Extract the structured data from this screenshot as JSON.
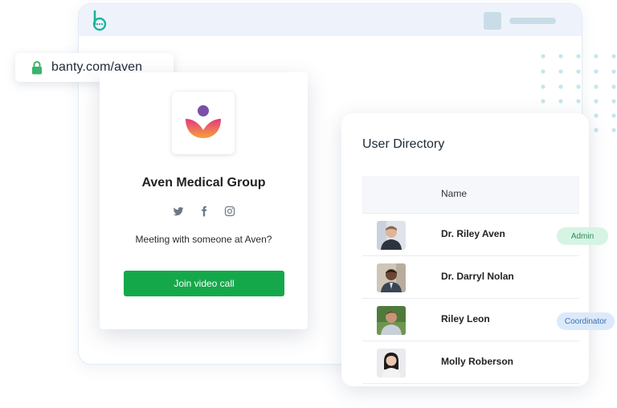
{
  "url_bar": {
    "text": "banty.com/aven",
    "icon": "lock-icon"
  },
  "brand": {
    "accent": "#15a84a",
    "logo_icon": "banty-logo-icon"
  },
  "profile_card": {
    "org_name": "Aven Medical Group",
    "socials": [
      "twitter-icon",
      "facebook-icon",
      "instagram-icon"
    ],
    "meeting_text": "Meeting with someone at Aven?",
    "join_button_label": "Join video call"
  },
  "directory": {
    "title": "User Directory",
    "column_header": "Name",
    "users": [
      {
        "name": "Dr. Riley Aven",
        "badge": "Admin"
      },
      {
        "name": "Dr. Darryl Nolan",
        "badge": ""
      },
      {
        "name": "Riley Leon",
        "badge": "Coordinator"
      },
      {
        "name": "Molly Roberson",
        "badge": ""
      }
    ]
  }
}
